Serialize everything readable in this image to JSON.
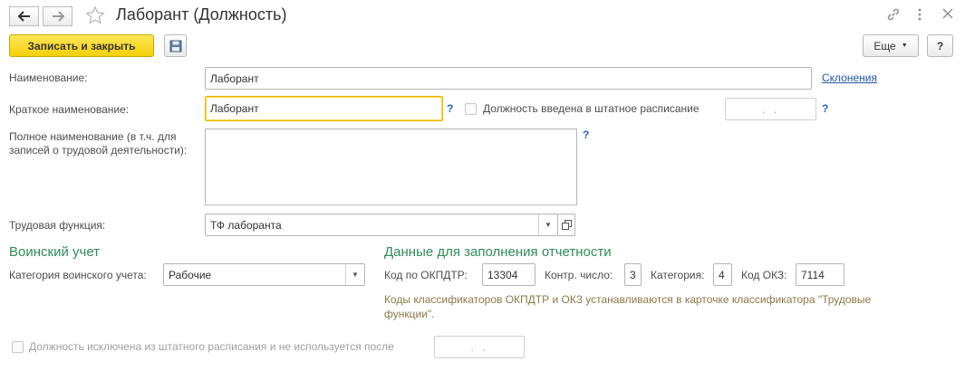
{
  "window": {
    "title": "Лаборант (Должность)"
  },
  "toolbar": {
    "save_close_label": "Записать и закрыть",
    "more_label": "Еще",
    "help_label": "?"
  },
  "form": {
    "name_label": "Наименование:",
    "name_value": "Лаборант",
    "declensions_link": "Склонения",
    "short_name_label": "Краткое наименование:",
    "short_name_value": "Лаборант",
    "help_mark": "?",
    "in_staff_label": "Должность введена в штатное расписание",
    "in_staff_date": ". .",
    "full_name_label_line1": "Полное наименование (в т.ч. для",
    "full_name_label_line2": "записей о трудовой деятельности):",
    "full_name_value": "",
    "labor_function_label": "Трудовая функция:",
    "labor_function_value": "ТФ лаборанта"
  },
  "military": {
    "title": "Воинский учет",
    "category_label": "Категория воинского учета:",
    "category_value": "Рабочие"
  },
  "reporting": {
    "title": "Данные для заполнения отчетности",
    "okpdtr_label": "Код по ОКПДТР:",
    "okpdtr_value": "13304",
    "control_label": "Контр. число:",
    "control_value": "3",
    "category_label": "Категория:",
    "category_value": "4",
    "okz_label": "Код ОКЗ:",
    "okz_value": "7114",
    "note_line1": "Коды классификаторов ОКПДТР и ОКЗ устанавливаются в карточке классификатора \"Трудовые",
    "note_line2": "функции\"."
  },
  "footer": {
    "excluded_label": "Должность исключена из штатного расписания и не используется после",
    "excluded_date": ". ."
  }
}
